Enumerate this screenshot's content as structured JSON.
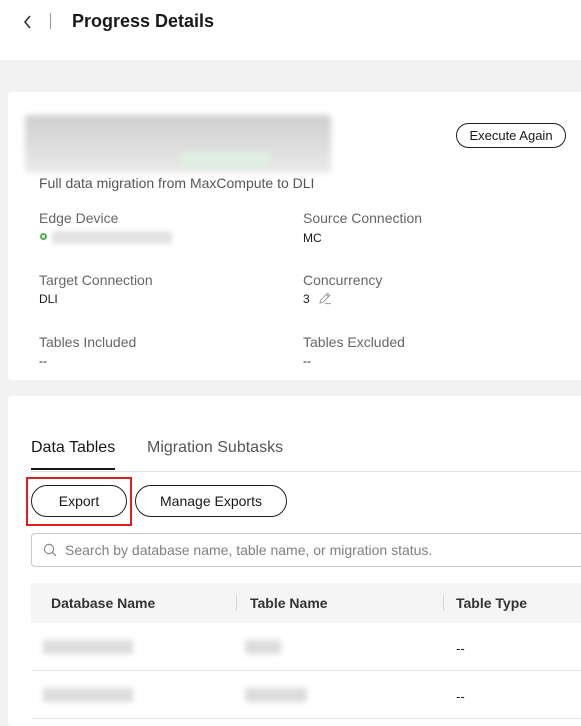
{
  "header": {
    "title": "Progress Details"
  },
  "task": {
    "execute_again_label": "Execute Again",
    "description": "Full data migration from MaxCompute to DLI"
  },
  "fields": {
    "edge_device_label": "Edge Device",
    "source_connection_label": "Source Connection",
    "source_connection_value": "MC",
    "target_connection_label": "Target Connection",
    "target_connection_value": "DLI",
    "concurrency_label": "Concurrency",
    "concurrency_value": "3",
    "tables_included_label": "Tables Included",
    "tables_included_value": "--",
    "tables_excluded_label": "Tables Excluded",
    "tables_excluded_value": "--",
    "edge_device_status_color": "#4caf50"
  },
  "tabs": [
    {
      "label": "Data Tables",
      "active": true
    },
    {
      "label": "Migration Subtasks",
      "active": false
    }
  ],
  "toolbar": {
    "export_label": "Export",
    "manage_exports_label": "Manage Exports"
  },
  "search": {
    "placeholder": "Search by database name, table name, or migration status.",
    "value": ""
  },
  "table": {
    "columns": [
      "Database Name",
      "Table Name",
      "Table Type"
    ],
    "rows": [
      {
        "table_type": "--"
      },
      {
        "table_type": "--"
      }
    ]
  },
  "colors": {
    "highlight": "#e02020",
    "status_online": "#4caf50"
  }
}
